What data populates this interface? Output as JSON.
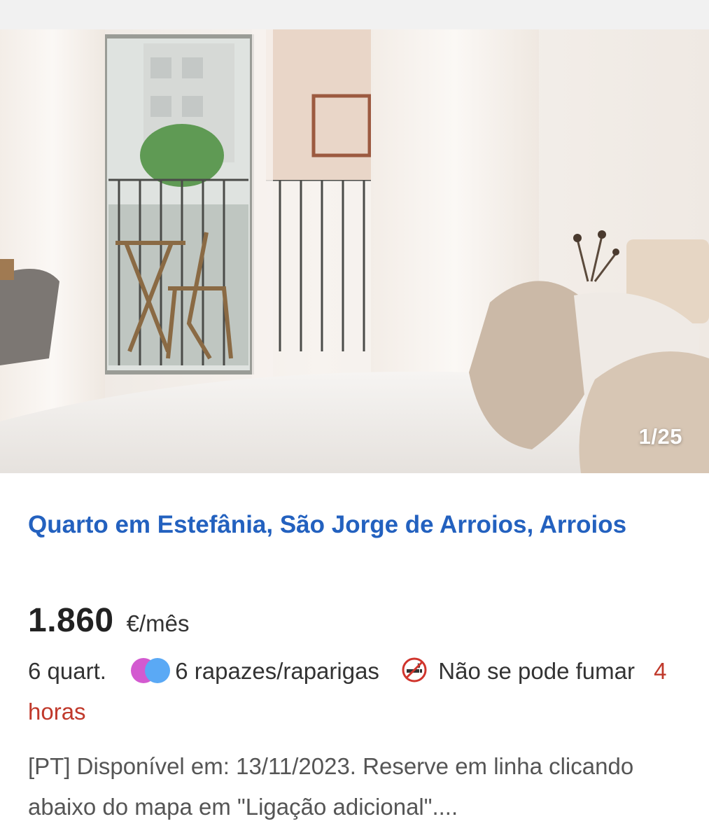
{
  "photo": {
    "alt": "Quarto com varanda",
    "counter": "1/25"
  },
  "listing": {
    "title": "Quarto em Estefânia, São Jorge de Arroios, Arroios",
    "price_amount": "1.860",
    "price_unit": "€/mês",
    "rooms": "6 quart.",
    "gender": "6 rapazes/raparigas",
    "smoking": "Não se pode fumar",
    "posted": "4 horas",
    "description": "[PT] Disponível em: 13/11/2023. Reserve em linha clicando abaixo do mapa em \"Ligação adicional\"...."
  },
  "colors": {
    "title": "#2361bf",
    "posted": "#c0392b",
    "gender_pink": "#d35ad0",
    "gender_blue": "#5aa9f5",
    "no_smoking": "#d0342c"
  },
  "icons": {
    "gender": "gender-mixed-icon",
    "smoking": "no-smoking-icon"
  }
}
